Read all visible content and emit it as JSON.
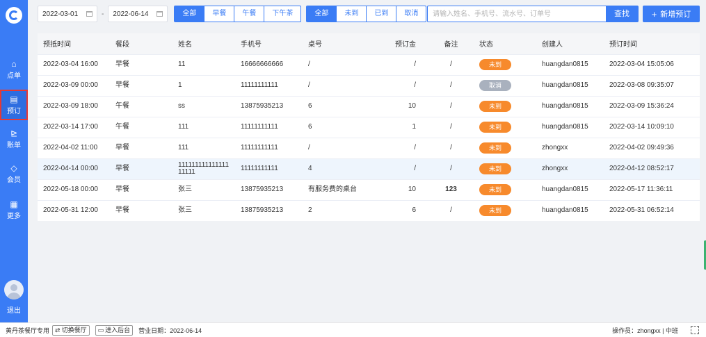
{
  "sidebar": {
    "items": [
      {
        "label": "点单",
        "icon": "⌂"
      },
      {
        "label": "预订",
        "icon": "▤"
      },
      {
        "label": "账单",
        "icon": "⊵"
      },
      {
        "label": "会员",
        "icon": "◇"
      },
      {
        "label": "更多",
        "icon": "▦"
      }
    ],
    "logout": "退出"
  },
  "filters": {
    "start_date": "2022-03-01",
    "end_date": "2022-06-14",
    "meal_options": [
      "全部",
      "早餐",
      "午餐",
      "下午茶"
    ],
    "status_options": [
      "全部",
      "未到",
      "已到",
      "取消"
    ]
  },
  "search": {
    "placeholder": "请输入姓名、手机号、流水号、订单号",
    "button": "查找"
  },
  "add_button": "新增预订",
  "table": {
    "headers": [
      "预抵时间",
      "餐段",
      "姓名",
      "手机号",
      "桌号",
      "预订金",
      "备注",
      "状态",
      "创建人",
      "预订时间"
    ],
    "rows": [
      {
        "arrive": "2022-03-04 16:00",
        "meal": "早餐",
        "name": "11",
        "phone": "16666666666",
        "table": "/",
        "deposit": "/",
        "note": "/",
        "status": "未到",
        "creator": "huangdan0815",
        "booked": "2022-03-04 15:05:06"
      },
      {
        "arrive": "2022-03-09 00:00",
        "meal": "早餐",
        "name": "1",
        "phone": "11111111111",
        "table": "/",
        "deposit": "/",
        "note": "/",
        "status": "取消",
        "creator": "huangdan0815",
        "booked": "2022-03-08 09:35:07"
      },
      {
        "arrive": "2022-03-09 18:00",
        "meal": "午餐",
        "name": "ss",
        "phone": "13875935213",
        "table": "6",
        "deposit": "10",
        "note": "/",
        "status": "未到",
        "creator": "huangdan0815",
        "booked": "2022-03-09 15:36:24"
      },
      {
        "arrive": "2022-03-14 17:00",
        "meal": "午餐",
        "name": "111",
        "phone": "11111111111",
        "table": "6",
        "deposit": "1",
        "note": "/",
        "status": "未到",
        "creator": "huangdan0815",
        "booked": "2022-03-14 10:09:10"
      },
      {
        "arrive": "2022-04-02 11:00",
        "meal": "早餐",
        "name": "111",
        "phone": "11111111111",
        "table": "/",
        "deposit": "/",
        "note": "/",
        "status": "未到",
        "creator": "zhongxx",
        "booked": "2022-04-02 09:49:36"
      },
      {
        "arrive": "2022-04-14 00:00",
        "meal": "早餐",
        "name": "11111111111111111111",
        "phone": "11111111111",
        "table": "4",
        "deposit": "/",
        "note": "/",
        "status": "未到",
        "creator": "zhongxx",
        "booked": "2022-04-12 08:52:17"
      },
      {
        "arrive": "2022-05-18 00:00",
        "meal": "早餐",
        "name": "张三",
        "phone": "13875935213",
        "table": "有服务费的桌台",
        "deposit": "10",
        "note": "123",
        "status": "未到",
        "creator": "huangdan0815",
        "booked": "2022-05-17 11:36:11"
      },
      {
        "arrive": "2022-05-31 12:00",
        "meal": "早餐",
        "name": "张三",
        "phone": "13875935213",
        "table": "2",
        "deposit": "6",
        "note": "/",
        "status": "未到",
        "creator": "huangdan0815",
        "booked": "2022-05-31 06:52:14"
      }
    ]
  },
  "footer": {
    "shop": "黄丹茶餐厅专用",
    "switch_btn": "切换餐厅",
    "backend_btn": "进入后台",
    "business_date": "营业日期：2022-06-14",
    "operator": "操作员：zhongxx | 中班"
  },
  "colors": {
    "primary": "#3a7cf5",
    "status_pending": "#f78a2c",
    "status_cancelled": "#a9b1be"
  }
}
